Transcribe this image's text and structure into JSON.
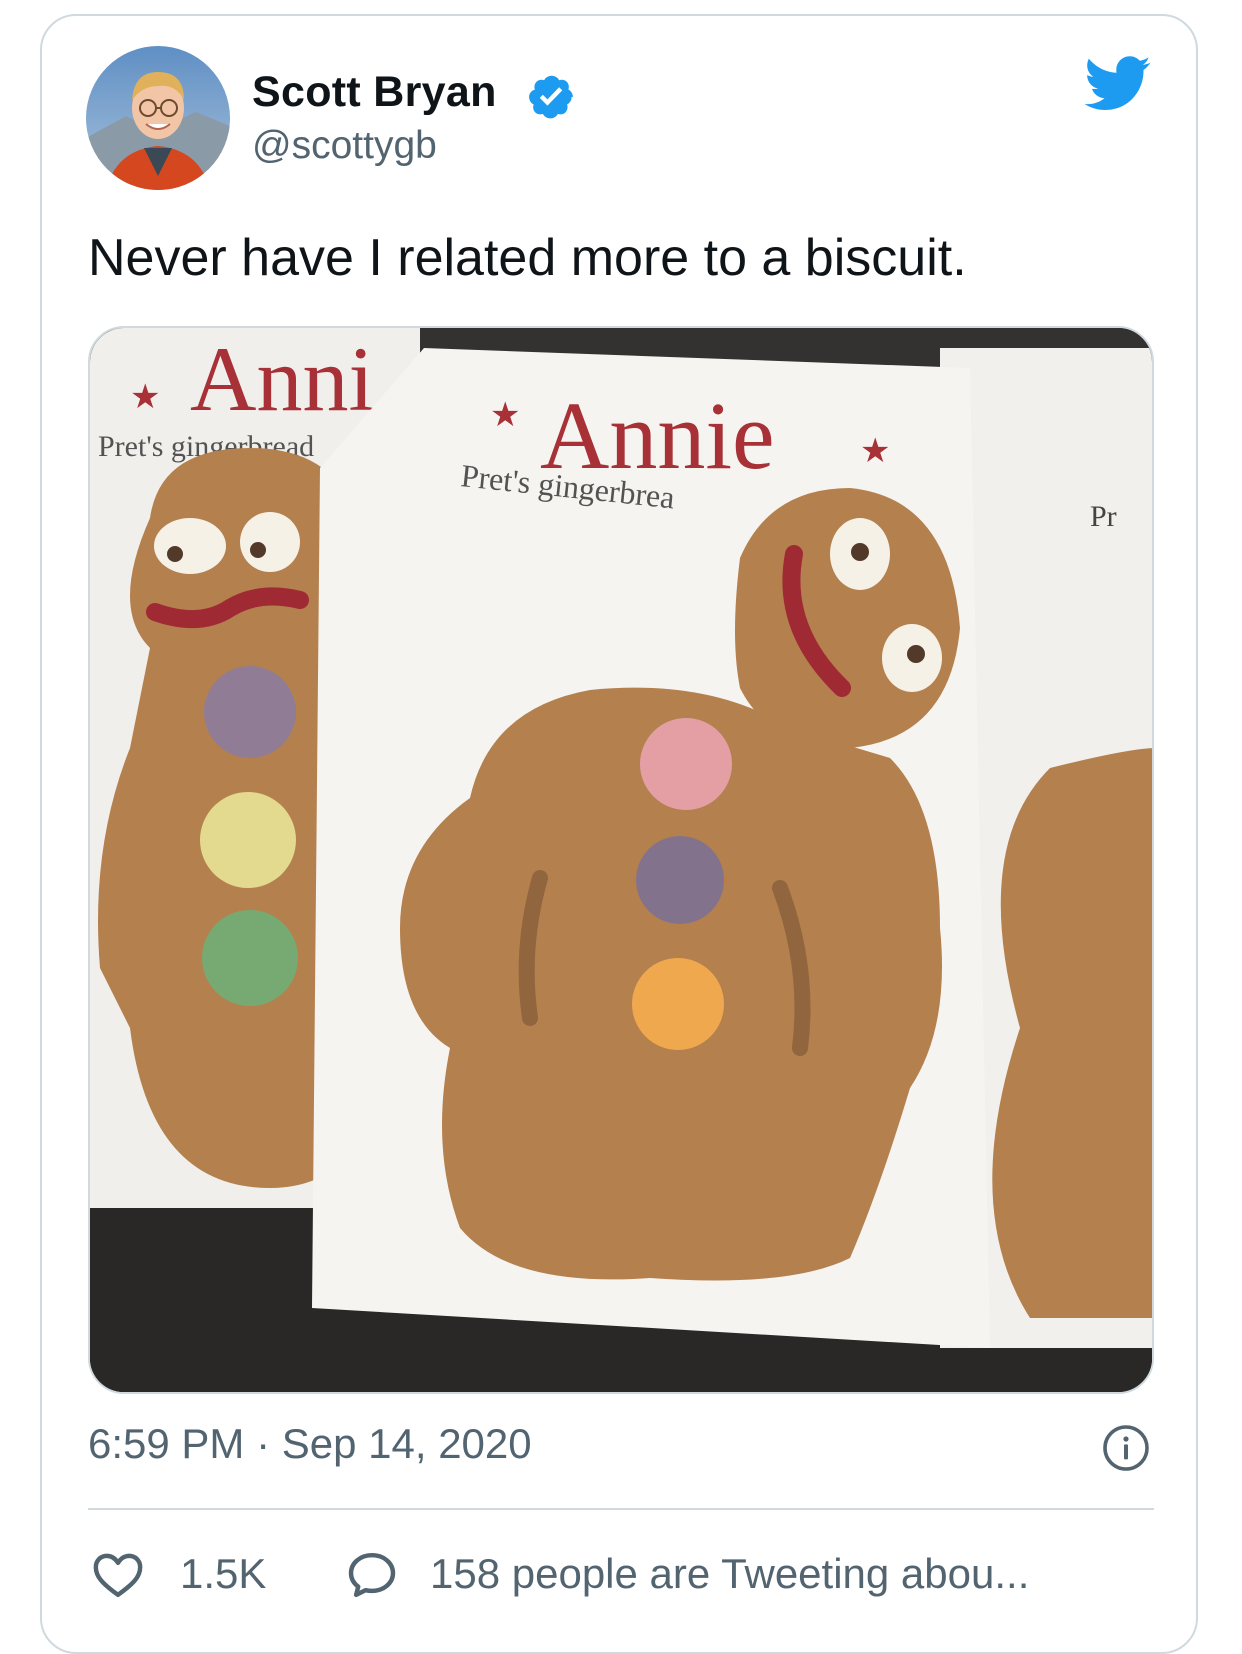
{
  "tweet": {
    "author": {
      "display_name": "Scott Bryan",
      "handle": "@scottygb",
      "verified": true
    },
    "text": "Never have I related more to a biscuit.",
    "media": {
      "package_title_left": "Anni",
      "package_subtitle_left": "Pret's gingerbread",
      "package_title_center": "Annie",
      "package_subtitle_center": "Pret's gingerbrea",
      "package_subtitle_right": "Pr"
    },
    "timestamp": "6:59 PM · Sep 14, 2020",
    "likes": "1.5K",
    "tweeting_text": "158 people are Tweeting abou..."
  },
  "icons": {
    "brand": "twitter-bird-icon",
    "verified": "verified-badge-icon",
    "info": "info-icon",
    "like": "heart-icon",
    "reply": "speech-bubble-icon"
  },
  "colors": {
    "twitter_blue": "#1d9bf0",
    "text_primary": "#0f1419",
    "text_secondary": "#536471",
    "border": "#cfd9de",
    "package_red": "#a3262c",
    "gingerbread": "#b07a45"
  }
}
